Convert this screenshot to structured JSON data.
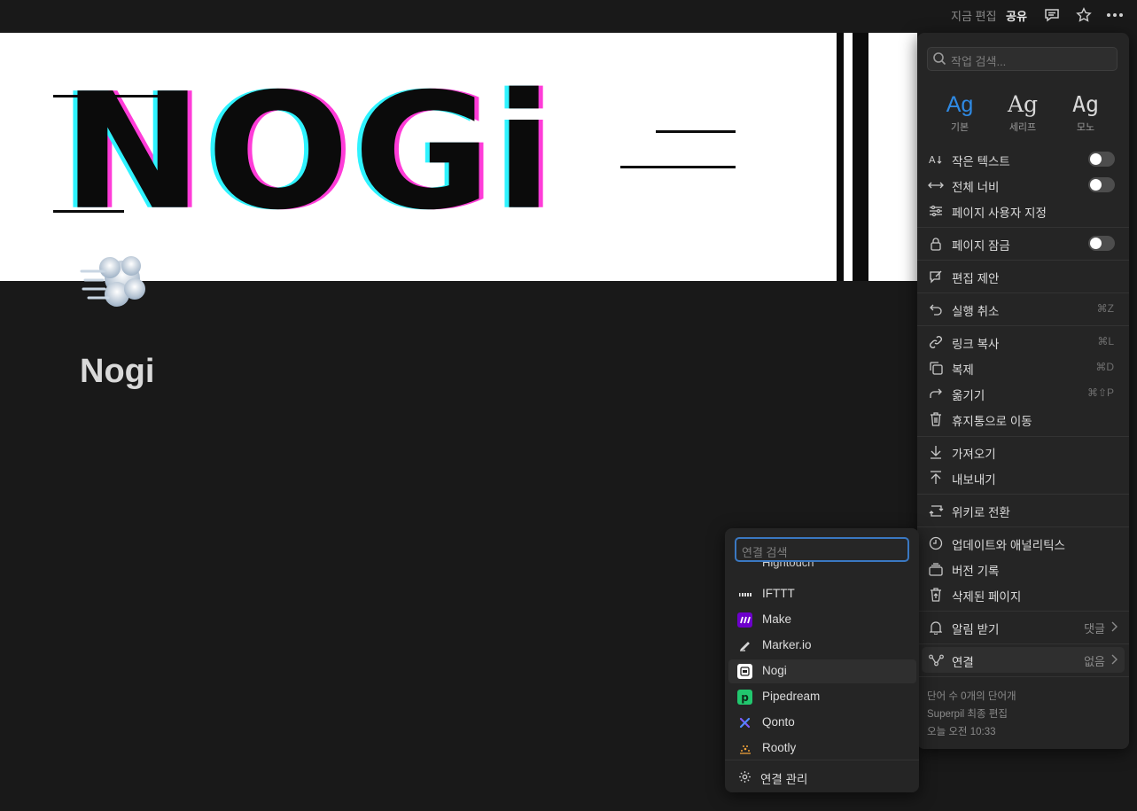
{
  "topbar": {
    "edited": "지금 편집",
    "share": "공유",
    "icons": [
      "comment-icon",
      "star-icon",
      "more-icon"
    ]
  },
  "cover": {
    "text": "NOGi"
  },
  "page": {
    "emoji": "dashing-away-emoji",
    "title": "Nogi"
  },
  "menu": {
    "search_placeholder": "작업 검색...",
    "fonts": [
      {
        "sample": "Ag",
        "label": "기본",
        "active": true
      },
      {
        "sample": "Ag",
        "label": "세리프",
        "active": false
      },
      {
        "sample": "Ag",
        "label": "모노",
        "active": false
      }
    ],
    "small_text": "작은 텍스트",
    "full_width": "전체 너비",
    "customize": "페이지 사용자 지정",
    "lock": "페이지 잠금",
    "suggest": "편집 제안",
    "undo": "실행 취소",
    "undo_sc": "⌘Z",
    "copy_link": "링크 복사",
    "copy_link_sc": "⌘L",
    "duplicate": "복제",
    "duplicate_sc": "⌘D",
    "move": "옮기기",
    "move_sc": "⌘⇧P",
    "trash": "휴지통으로 이동",
    "import": "가져오기",
    "export": "내보내기",
    "wiki": "위키로 전환",
    "updates": "업데이트와 애널리틱스",
    "history": "버전 기록",
    "deleted": "삭제된 페이지",
    "notify": "알림 받기",
    "notify_value": "댓글",
    "connect": "연결",
    "connect_value": "없음",
    "footer_words": "단어 수 0개의 단어개",
    "footer_edited_by": "Superpil 최종 편집",
    "footer_time": "오늘 오전 10:33"
  },
  "connections": {
    "search_placeholder": "연결 검색",
    "peek_item": "Hightouch",
    "items": [
      {
        "label": "IFTTT",
        "icon": "ifttt-icon",
        "color": "#252525"
      },
      {
        "label": "Make",
        "icon": "make-icon",
        "color": "#6d00cc"
      },
      {
        "label": "Marker.io",
        "icon": "marker-io-icon",
        "color": "#252525"
      },
      {
        "label": "Nogi",
        "icon": "nogi-icon",
        "color": "#ffffff"
      },
      {
        "label": "Pipedream",
        "icon": "pipedream-icon",
        "color": "#21c76e"
      },
      {
        "label": "Qonto",
        "icon": "qonto-icon",
        "color": "#252525"
      },
      {
        "label": "Rootly",
        "icon": "rootly-icon",
        "color": "#252525"
      }
    ],
    "manage": "연결 관리"
  }
}
